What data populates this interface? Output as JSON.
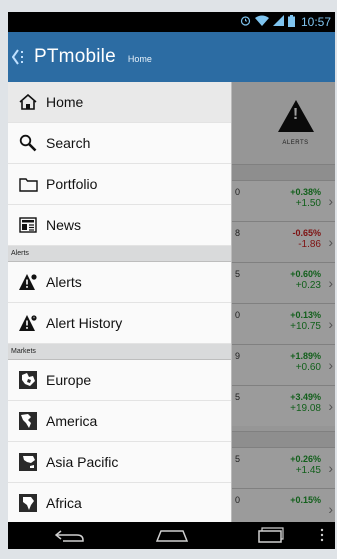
{
  "status_bar": {
    "time": "10:57",
    "icons": [
      "alarm-icon",
      "wifi-icon",
      "signal-icon",
      "battery-icon"
    ],
    "color": "#7fc4ef"
  },
  "action_bar": {
    "title": "PTmobile",
    "subtitle": "Home",
    "color": "#2c6ca3"
  },
  "drawer": {
    "groups": [
      {
        "header": "",
        "items": [
          {
            "label": "Home",
            "icon": "home-icon",
            "active": true
          },
          {
            "label": "Search",
            "icon": "search-icon"
          },
          {
            "label": "Portfolio",
            "icon": "folder-icon"
          },
          {
            "label": "News",
            "icon": "news-icon"
          }
        ]
      },
      {
        "header": "Alerts",
        "items": [
          {
            "label": "Alerts",
            "icon": "alert-icon"
          },
          {
            "label": "Alert History",
            "icon": "alert-history-icon"
          }
        ]
      },
      {
        "header": "Markets",
        "items": [
          {
            "label": "Europe",
            "icon": "europe-map-icon"
          },
          {
            "label": "America",
            "icon": "america-map-icon"
          },
          {
            "label": "Asia Pacific",
            "icon": "asia-pacific-map-icon"
          },
          {
            "label": "Africa",
            "icon": "africa-map-icon"
          }
        ]
      }
    ]
  },
  "background": {
    "alerts_tile_label": "ALERTS",
    "rows": [
      {
        "mini": "0",
        "pct": "+0.38%",
        "chg": "+1.50",
        "dir": "up"
      },
      {
        "mini": "8",
        "pct": "-0.65%",
        "chg": "-1.86",
        "dir": "down"
      },
      {
        "mini": "5",
        "pct": "+0.60%",
        "chg": "+0.23",
        "dir": "up"
      },
      {
        "mini": "0",
        "pct": "+0.13%",
        "chg": "+10.75",
        "dir": "up"
      },
      {
        "mini": "9",
        "pct": "+1.89%",
        "chg": "+0.60",
        "dir": "up"
      },
      {
        "mini": "5",
        "pct": "+3.49%",
        "chg": "+19.08",
        "dir": "up"
      },
      {
        "mini": "5",
        "pct": "+0.26%",
        "chg": "+1.45",
        "dir": "up"
      },
      {
        "mini": "0",
        "pct": "+0.15%",
        "chg": "",
        "dir": "up"
      }
    ],
    "up_color": "#1d9a2c",
    "down_color": "#cc1f1f"
  },
  "nav_bar": {
    "buttons": [
      "back-icon",
      "home-nav-icon",
      "recents-icon",
      "overflow-menu-icon"
    ]
  }
}
